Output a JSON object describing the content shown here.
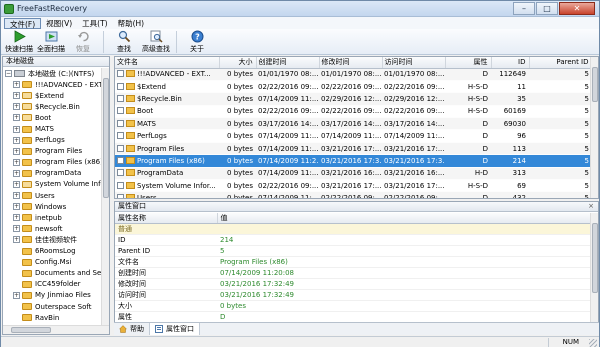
{
  "window": {
    "title": "FreeFastRecovery",
    "minimize": "–",
    "maximize": "□",
    "close": "✕"
  },
  "menu": [
    "文件(F)",
    "视图(V)",
    "工具(T)",
    "帮助(H)"
  ],
  "toolbar": {
    "quick_scan": "快速扫描",
    "full_scan": "全面扫描",
    "recover": "恢复",
    "find": "查找",
    "advanced_find": "高级查找",
    "about": "关于"
  },
  "tree": {
    "header": "本地磁盘",
    "root": "本地磁盘 (C:)(NTFS)",
    "items": [
      "!!!ADVANCED - EXT",
      "$Extend",
      "$Recycle.Bin",
      "Boot",
      "MATS",
      "PerfLogs",
      "Program Files",
      "Program Files (x86)",
      "ProgramData",
      "System Volume Info",
      "Users",
      "Windows",
      "inetpub",
      "newsoft",
      "佳佳视频软件",
      "6RoomsLog",
      "Config.Msi",
      "Documents and Settings",
      "ICC459folder",
      "My Jinmiao Files",
      "Outerspace Soft",
      "RavBin"
    ]
  },
  "files": {
    "columns": [
      "文件名",
      "大小",
      "创建时间",
      "修改时间",
      "访问时间",
      "属性",
      "ID",
      "Parent ID"
    ],
    "rows": [
      {
        "name": "!!!ADVANCED - EXT...",
        "size": "0 bytes",
        "created": "01/01/1970 08:...",
        "modified": "01/01/1970 08:...",
        "accessed": "01/01/1970 08:...",
        "attr": "D",
        "id": "112649",
        "parent": "5"
      },
      {
        "name": "$Extend",
        "size": "0 bytes",
        "created": "02/22/2016 09:...",
        "modified": "02/22/2016 09:...",
        "accessed": "02/22/2016 09:...",
        "attr": "H-S-D",
        "id": "11",
        "parent": "5"
      },
      {
        "name": "$Recycle.Bin",
        "size": "0 bytes",
        "created": "07/14/2009 11:...",
        "modified": "02/29/2016 12:...",
        "accessed": "02/29/2016 12:...",
        "attr": "H-S-D",
        "id": "35",
        "parent": "5"
      },
      {
        "name": "Boot",
        "size": "0 bytes",
        "created": "02/22/2016 09:...",
        "modified": "02/22/2016 09:...",
        "accessed": "02/22/2016 09:...",
        "attr": "H-S-D",
        "id": "60169",
        "parent": "5"
      },
      {
        "name": "MATS",
        "size": "0 bytes",
        "created": "03/17/2016 14:...",
        "modified": "03/17/2016 14:...",
        "accessed": "03/17/2016 14:...",
        "attr": "D",
        "id": "69030",
        "parent": "5"
      },
      {
        "name": "PerfLogs",
        "size": "0 bytes",
        "created": "07/14/2009 11:...",
        "modified": "07/14/2009 11:...",
        "accessed": "07/14/2009 11:...",
        "attr": "D",
        "id": "96",
        "parent": "5"
      },
      {
        "name": "Program Files",
        "size": "0 bytes",
        "created": "07/14/2009 11:...",
        "modified": "03/21/2016 17:...",
        "accessed": "03/21/2016 17:...",
        "attr": "D",
        "id": "113",
        "parent": "5"
      },
      {
        "name": "Program Files (x86)",
        "size": "0 bytes",
        "created": "07/14/2009 11:2...",
        "modified": "03/21/2016 17:3...",
        "accessed": "03/21/2016 17:3...",
        "attr": "D",
        "id": "214",
        "parent": "5"
      },
      {
        "name": "ProgramData",
        "size": "0 bytes",
        "created": "07/14/2009 11:...",
        "modified": "03/21/2016 16:...",
        "accessed": "03/21/2016 16:...",
        "attr": "H-D",
        "id": "313",
        "parent": "5"
      },
      {
        "name": "System Volume Infor...",
        "size": "0 bytes",
        "created": "02/22/2016 09:...",
        "modified": "03/21/2016 17:...",
        "accessed": "03/21/2016 17:...",
        "attr": "H-S-D",
        "id": "69",
        "parent": "5"
      },
      {
        "name": "Users",
        "size": "0 bytes",
        "created": "07/14/2009 11:...",
        "modified": "02/22/2016 09:...",
        "accessed": "02/22/2016 09:...",
        "attr": "D",
        "id": "432",
        "parent": "5"
      }
    ],
    "selected_index": 7
  },
  "properties": {
    "title": "属性窗口",
    "close": "×",
    "col_name": "属性名称",
    "col_value": "值",
    "group": "普通",
    "rows": [
      {
        "name": "ID",
        "value": "214"
      },
      {
        "name": "Parent ID",
        "value": "5"
      },
      {
        "name": "文件名",
        "value": "Program Files (x86)"
      },
      {
        "name": "创建时间",
        "value": "07/14/2009 11:20:08"
      },
      {
        "name": "修改时间",
        "value": "03/21/2016 17:32:49"
      },
      {
        "name": "访问时间",
        "value": "03/21/2016 17:32:49"
      },
      {
        "name": "大小",
        "value": "0 bytes"
      },
      {
        "name": "属性",
        "value": "D"
      }
    ]
  },
  "tabs": {
    "help": "帮助",
    "properties": "属性窗口"
  },
  "status": {
    "num": "NUM"
  }
}
